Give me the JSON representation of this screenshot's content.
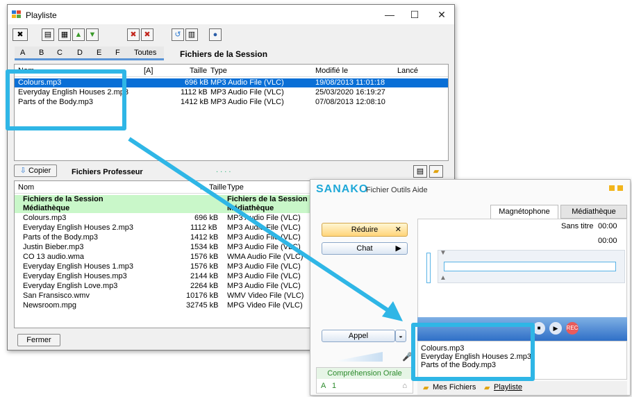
{
  "playlist": {
    "window_title": "Playliste",
    "win_min": "—",
    "win_max": "☐",
    "win_close": "✕",
    "letters": [
      "A",
      "B",
      "C",
      "D",
      "E",
      "F"
    ],
    "all_tab": "Toutes",
    "session_title": "Fichiers de la Session",
    "columns": {
      "name": "Nom",
      "flag": "[A]",
      "size": "Taille",
      "type": "Type",
      "modified": "Modifié le",
      "launched": "Lancé"
    },
    "session_files": [
      {
        "name": "Colours.mp3",
        "size": "696 kB",
        "type": "MP3 Audio File (VLC)",
        "modified": "19/08/2013 11:01:18"
      },
      {
        "name": "Everyday English Houses 2.mp3",
        "size": "1112 kB",
        "type": "MP3 Audio File (VLC)",
        "modified": "25/03/2020 16:19:27"
      },
      {
        "name": "Parts of the Body.mp3",
        "size": "1412 kB",
        "type": "MP3 Audio File (VLC)",
        "modified": "07/08/2013 12:08:10"
      }
    ],
    "copy_button": "Copier",
    "teacher_title": "Fichiers Professeur",
    "dots": ". . . .",
    "teacher_columns": {
      "name": "Nom",
      "size": "Taille",
      "type": "Type"
    },
    "teacher_groups": [
      {
        "name": "Fichiers de la Session",
        "type": "Fichiers de la Session"
      },
      {
        "name": "Médiathèque",
        "type": "Médiathèque"
      }
    ],
    "teacher_files": [
      {
        "name": "Colours.mp3",
        "size": "696 kB",
        "type": "MP3 Audio File (VLC)"
      },
      {
        "name": "Everyday English Houses 2.mp3",
        "size": "1112 kB",
        "type": "MP3 Audio File (VLC)"
      },
      {
        "name": "Parts of the Body.mp3",
        "size": "1412 kB",
        "type": "MP3 Audio File (VLC)"
      },
      {
        "name": "Justin Bieber.mp3",
        "size": "1534 kB",
        "type": "MP3 Audio File (VLC)"
      },
      {
        "name": "CO 13 audio.wma",
        "size": "1576 kB",
        "type": "WMA Audio File (VLC)"
      },
      {
        "name": "Everyday English Houses 1.mp3",
        "size": "1576 kB",
        "type": "MP3 Audio File (VLC)"
      },
      {
        "name": "Everyday English Houses.mp3",
        "size": "2144 kB",
        "type": "MP3 Audio File (VLC)"
      },
      {
        "name": "Everyday English Love.mp3",
        "size": "2264 kB",
        "type": "MP3 Audio File (VLC)"
      },
      {
        "name": "San Fransisco.wmv",
        "size": "10176 kB",
        "type": "WMV Video File (VLC)"
      },
      {
        "name": "Newsroom.mpg",
        "size": "32745 kB",
        "type": "MPG Video File (VLC)"
      }
    ],
    "close_button": "Fermer"
  },
  "sanako": {
    "logo": "SANAKO",
    "menu": "Fichier Outils Aide",
    "tab_recorder": "Magnétophone",
    "tab_library": "Médiathèque",
    "untitled": "Sans titre",
    "time1": "00:00",
    "time2": "00:00",
    "reduce_button": "Réduire",
    "chat_button": "Chat",
    "call_button": "Appel",
    "playlist_items": [
      "Colours.mp3",
      "Everyday English Houses 2.mp3",
      "Parts of the Body.mp3"
    ],
    "comprehension": "Compréhension Orale",
    "comp_a": "A",
    "comp_num": "1",
    "my_files": "Mes Fichiers",
    "playlist_link": "Playliste"
  },
  "colors": {
    "highlight": "#2fb6e6",
    "selection": "#0a6fd6",
    "group_row": "#c9f7c9"
  }
}
